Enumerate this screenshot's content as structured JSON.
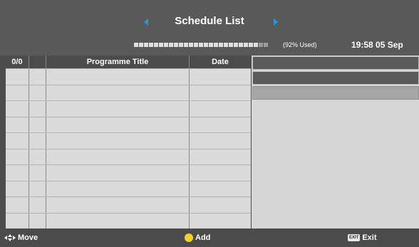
{
  "header": {
    "title": "Schedule List",
    "usage": "(92% Used)",
    "clock": "19:58 05 Sep",
    "accent_color": "#1e9be0",
    "usage_fraction": 0.92
  },
  "table": {
    "columns": [
      "0/0",
      "Programme Title",
      "Date"
    ],
    "rows": 10
  },
  "footer": {
    "move_label": "Move",
    "add_label": "Add",
    "exit_label": "Exit",
    "exit_key": "EXIT",
    "add_color": "#f2d22b"
  },
  "icons": [
    "left-arrow-icon",
    "right-arrow-icon",
    "navigation-arrows-icon",
    "yellow-button-icon",
    "exit-key-icon"
  ]
}
